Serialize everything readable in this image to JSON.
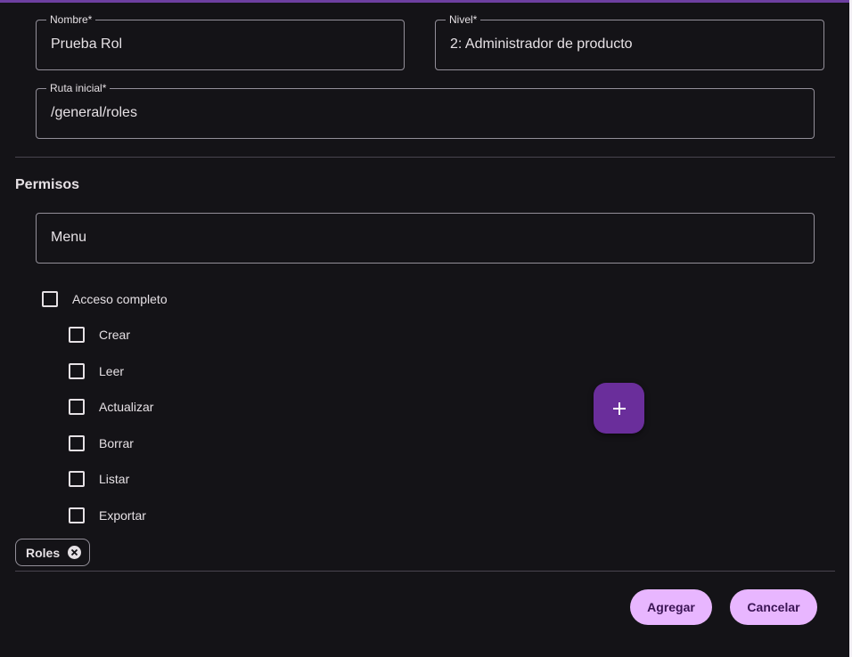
{
  "form": {
    "nombre": {
      "label": "Nombre*",
      "value": "Prueba Rol"
    },
    "nivel": {
      "label": "Nivel*",
      "value": "2: Administrador de producto"
    },
    "ruta": {
      "label": "Ruta inicial*",
      "value": "/general/roles"
    }
  },
  "permisos": {
    "title": "Permisos",
    "menu_value": "Menu",
    "full_access": "Acceso completo",
    "options": [
      "Crear",
      "Leer",
      "Actualizar",
      "Borrar",
      "Listar",
      "Exportar"
    ]
  },
  "chips": [
    {
      "label": "Roles"
    }
  ],
  "actions": {
    "add": "Agregar",
    "cancel": "Cancelar"
  },
  "colors": {
    "accent": "#6a2e9b",
    "button": "#e8b6ff",
    "background": "#141317"
  },
  "icons": {
    "fab": "plus-icon",
    "chip_remove": "close-circle-icon"
  }
}
